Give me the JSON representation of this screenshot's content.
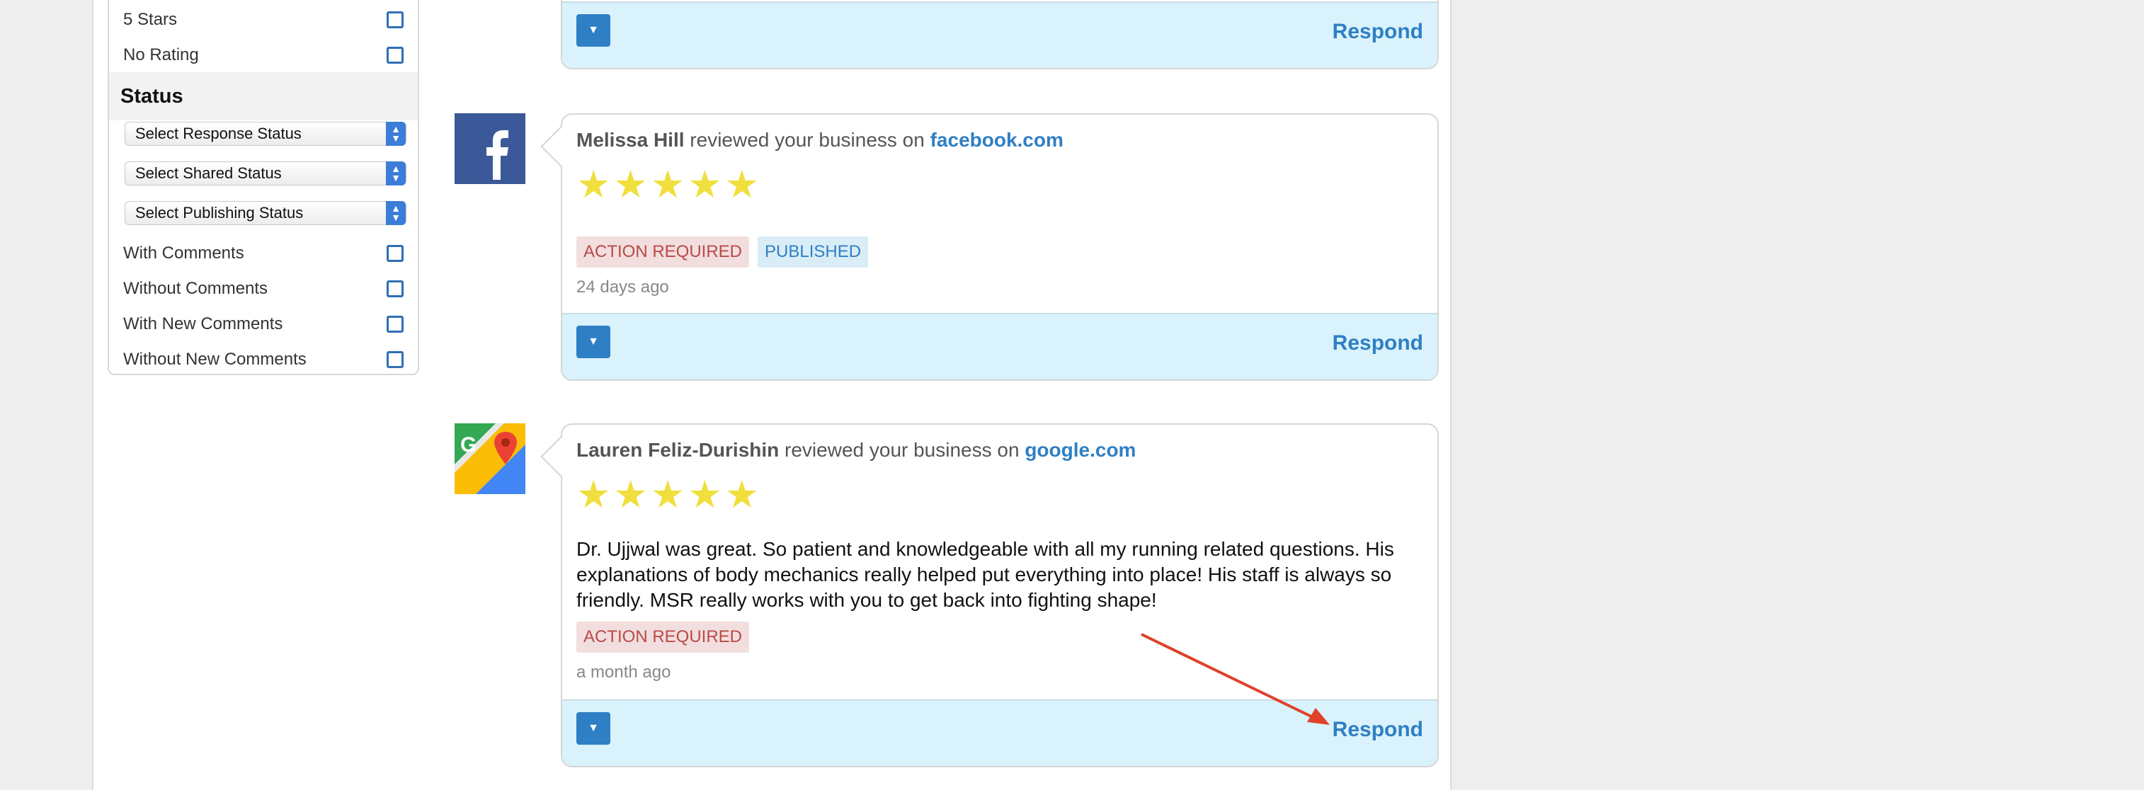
{
  "filters": {
    "ratings": [
      {
        "label": "5 Stars"
      },
      {
        "label": "No Rating"
      }
    ],
    "status_title": "Status",
    "selects": [
      {
        "label": "Select Response Status"
      },
      {
        "label": "Select Shared Status"
      },
      {
        "label": "Select Publishing Status"
      }
    ],
    "comments": [
      {
        "label": "With Comments"
      },
      {
        "label": "Without Comments"
      },
      {
        "label": "With New Comments"
      },
      {
        "label": "Without New Comments"
      }
    ]
  },
  "reviews": [
    {
      "respond_label": "Respond"
    },
    {
      "reviewer": "Melissa Hill",
      "reviewed_text": "reviewed your business on",
      "site": "facebook.com",
      "stars": "★★★★★",
      "rating": 5,
      "badges": [
        "ACTION REQUIRED",
        "PUBLISHED"
      ],
      "time": "24 days ago",
      "respond_label": "Respond"
    },
    {
      "reviewer": "Lauren Feliz-Durishin",
      "reviewed_text": "reviewed your business on",
      "site": "google.com",
      "stars": "★★★★★",
      "rating": 5,
      "text_lines": [
        "Dr. Ujjwal was great. So patient and knowledgeable with all my running related questions. His",
        "explanations of body mechanics really helped put everything into place! His staff is always so",
        "friendly. MSR really works with you to get back into fighting shape!"
      ],
      "badges": [
        "ACTION REQUIRED"
      ],
      "time": "a month ago",
      "respond_label": "Respond"
    }
  ],
  "colors": {
    "accent": "#2f7fc4",
    "star": "#f0df3c",
    "action_badge_bg": "#f2dede",
    "action_badge_text": "#b94a48",
    "footer_bg": "#d9f2fb",
    "annotation_arrow": "#e0412a"
  },
  "icons": {
    "facebook": "facebook-logo-icon",
    "google": "google-maps-logo-icon",
    "dropdown": "caret-down-icon"
  }
}
